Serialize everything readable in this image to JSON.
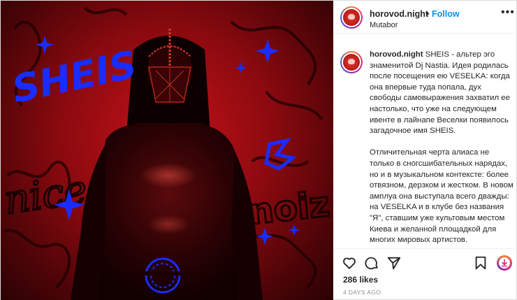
{
  "post": {
    "username": "horovod.night",
    "separator": "•",
    "follow_label": "Follow",
    "location": "Mutabor",
    "more_label": "•••",
    "photo_text": {
      "sheis": "SHEIS",
      "nice": "nice",
      "noiz": "noiz"
    },
    "caption": {
      "username": "horovod.night",
      "paragraph_1": "SHEIS - альтер эго знаменитой Dj Nastia. Идея родилась после посещения ею VESELKA: когда она впервые туда попала, дух свободы самовыражения захватил ее настолько, что уже на следующем ивенте в лайнапе Веселки появилось загадочное имя SHEIS.",
      "paragraph_2": "Отличительная черта алиаса не только в сногсшибательных нарядах, но и в музыкальном контексте: более отвязном, дерзком и жестком. В новом амплуа она выступала всего дважды: на VESELKA и в клубе без названия \"Я\", ставшим уже культовым местом Киева и желанной площадкой для многих мировых артистов."
    },
    "actions": {
      "like_icon": "heart-icon",
      "comment_icon": "comment-icon",
      "share_icon": "share-icon",
      "save_icon": "bookmark-icon",
      "download_icon": "download-icon"
    },
    "likes": "286 likes",
    "timestamp": "4 DAYS AGO"
  },
  "colors": {
    "accent": "#0095f6",
    "photo_red": "#c4121a",
    "graffiti_blue": "#1a2cff"
  }
}
